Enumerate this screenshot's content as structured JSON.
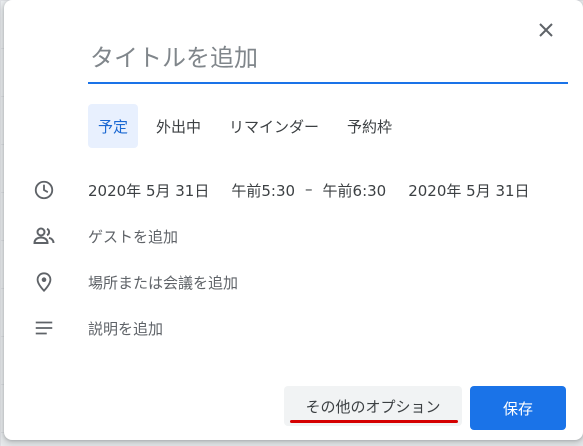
{
  "dialog": {
    "title_placeholder": "タイトルを追加",
    "tabs": [
      {
        "label": "予定",
        "active": true
      },
      {
        "label": "外出中",
        "active": false
      },
      {
        "label": "リマインダー",
        "active": false
      },
      {
        "label": "予約枠",
        "active": false
      }
    ],
    "datetime": {
      "start_date": "2020年 5月 31日",
      "start_time": "午前5:30",
      "separator": "–",
      "end_time": "午前6:30",
      "end_date": "2020年 5月 31日"
    },
    "guests_placeholder": "ゲストを追加",
    "location_placeholder": "場所または会議を追加",
    "description_placeholder": "説明を追加",
    "more_options_label": "その他のオプション",
    "save_label": "保存"
  },
  "colors": {
    "accent": "#1a73e8",
    "active_tab_bg": "#e8f0fe",
    "annotation_underline": "#d50000"
  },
  "icons": [
    "close-icon",
    "clock-icon",
    "people-icon",
    "location-pin-icon",
    "notes-icon"
  ]
}
